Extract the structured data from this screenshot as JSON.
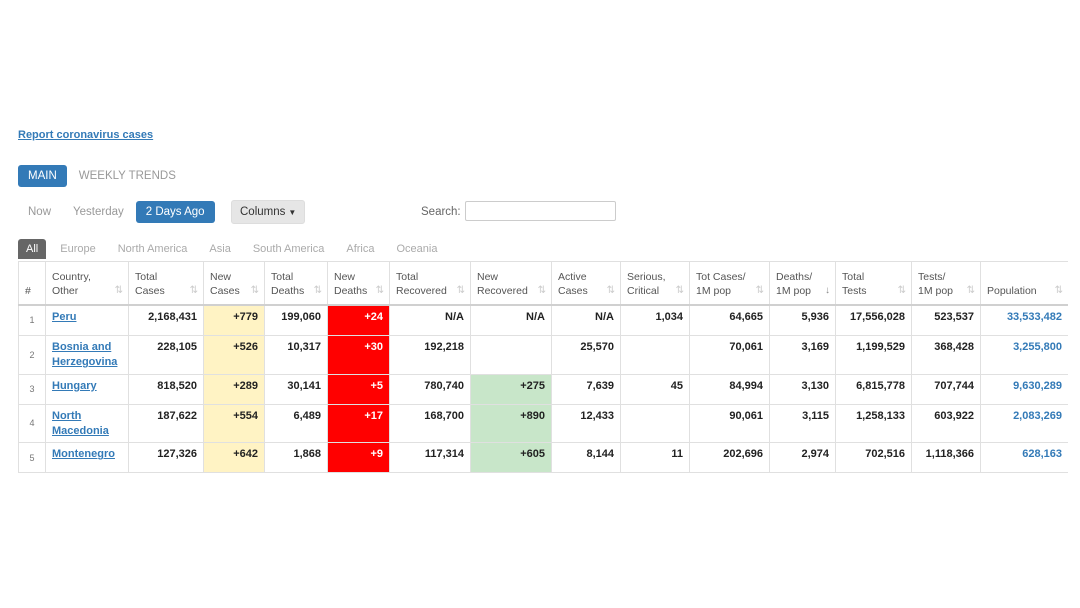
{
  "report_link": "Report coronavirus cases",
  "view_tabs": [
    {
      "label": "MAIN",
      "active": true
    },
    {
      "label": "WEEKLY TRENDS",
      "active": false
    }
  ],
  "day_tabs": [
    {
      "label": "Now",
      "active": false
    },
    {
      "label": "Yesterday",
      "active": false
    },
    {
      "label": "2 Days Ago",
      "active": true
    }
  ],
  "columns_button": "Columns",
  "search": {
    "label": "Search:",
    "value": ""
  },
  "region_tabs": [
    "All",
    "Europe",
    "North America",
    "Asia",
    "South America",
    "Africa",
    "Oceania"
  ],
  "table": {
    "headers": [
      {
        "line1": "#",
        "line2": ""
      },
      {
        "line1": "Country,",
        "line2": "Other"
      },
      {
        "line1": "Total",
        "line2": "Cases"
      },
      {
        "line1": "New",
        "line2": "Cases"
      },
      {
        "line1": "Total",
        "line2": "Deaths"
      },
      {
        "line1": "New",
        "line2": "Deaths"
      },
      {
        "line1": "Total",
        "line2": "Recovered"
      },
      {
        "line1": "New",
        "line2": "Recovered"
      },
      {
        "line1": "Active",
        "line2": "Cases"
      },
      {
        "line1": "Serious,",
        "line2": "Critical"
      },
      {
        "line1": "Tot Cases/",
        "line2": "1M pop"
      },
      {
        "line1": "Deaths/",
        "line2": "1M pop"
      },
      {
        "line1": "Total",
        "line2": "Tests"
      },
      {
        "line1": "Tests/",
        "line2": "1M pop"
      },
      {
        "line1": "Population",
        "line2": ""
      }
    ],
    "rows": [
      {
        "idx": "1",
        "country": "Peru",
        "total_cases": "2,168,431",
        "new_cases": "+779",
        "total_deaths": "199,060",
        "new_deaths": "+24",
        "total_recovered": "N/A",
        "new_recovered": "N/A",
        "active": "N/A",
        "critical": "1,034",
        "cases_1m": "64,665",
        "deaths_1m": "5,936",
        "total_tests": "17,556,028",
        "tests_1m": "523,537",
        "population": "33,533,482"
      },
      {
        "idx": "2",
        "country": "Bosnia and Herzegovina",
        "total_cases": "228,105",
        "new_cases": "+526",
        "total_deaths": "10,317",
        "new_deaths": "+30",
        "total_recovered": "192,218",
        "new_recovered": "",
        "active": "25,570",
        "critical": "",
        "cases_1m": "70,061",
        "deaths_1m": "3,169",
        "total_tests": "1,199,529",
        "tests_1m": "368,428",
        "population": "3,255,800"
      },
      {
        "idx": "3",
        "country": "Hungary",
        "total_cases": "818,520",
        "new_cases": "+289",
        "total_deaths": "30,141",
        "new_deaths": "+5",
        "total_recovered": "780,740",
        "new_recovered": "+275",
        "active": "7,639",
        "critical": "45",
        "cases_1m": "84,994",
        "deaths_1m": "3,130",
        "total_tests": "6,815,778",
        "tests_1m": "707,744",
        "population": "9,630,289"
      },
      {
        "idx": "4",
        "country": "North Macedonia",
        "total_cases": "187,622",
        "new_cases": "+554",
        "total_deaths": "6,489",
        "new_deaths": "+17",
        "total_recovered": "168,700",
        "new_recovered": "+890",
        "active": "12,433",
        "critical": "",
        "cases_1m": "90,061",
        "deaths_1m": "3,115",
        "total_tests": "1,258,133",
        "tests_1m": "603,922",
        "population": "2,083,269"
      },
      {
        "idx": "5",
        "country": "Montenegro",
        "total_cases": "127,326",
        "new_cases": "+642",
        "total_deaths": "1,868",
        "new_deaths": "+9",
        "total_recovered": "117,314",
        "new_recovered": "+605",
        "active": "8,144",
        "critical": "11",
        "cases_1m": "202,696",
        "deaths_1m": "2,974",
        "total_tests": "702,516",
        "tests_1m": "1,118,366",
        "population": "628,163"
      }
    ]
  }
}
